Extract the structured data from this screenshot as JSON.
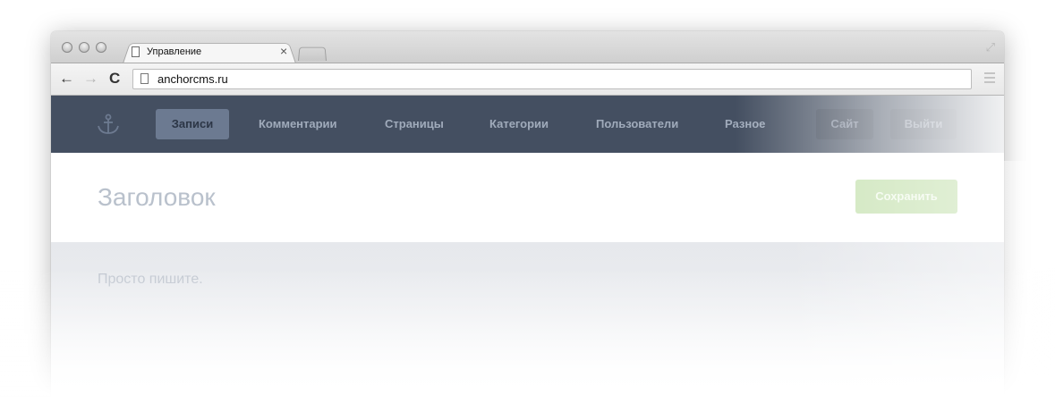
{
  "browser": {
    "tab_title": "Управление",
    "tab_close": "×",
    "url": "anchorcms.ru",
    "icons": {
      "back": "back-arrow-icon",
      "forward": "forward-arrow-icon",
      "reload": "reload-icon",
      "page": "document-icon",
      "menu": "menu-icon",
      "fullscreen": "fullscreen-icon"
    },
    "glyphs": {
      "back": "←",
      "forward": "→",
      "reload": "C",
      "fullscreen": "⤢"
    }
  },
  "nav": {
    "logo_icon": "anchor-icon",
    "items": [
      {
        "label": "Записи",
        "active": true
      },
      {
        "label": "Комментарии",
        "active": false
      },
      {
        "label": "Страницы",
        "active": false
      },
      {
        "label": "Категории",
        "active": false
      },
      {
        "label": "Пользователи",
        "active": false
      },
      {
        "label": "Разное",
        "active": false
      }
    ],
    "site_button": "Сайт",
    "logout_button": "Выйти"
  },
  "editor": {
    "title_placeholder": "Заголовок",
    "save_label": "Сохранить",
    "body_placeholder": "Просто пишите."
  },
  "colors": {
    "nav_bg": "#444f61",
    "nav_active": "#6c7a91",
    "save_button": "#cfe6bd"
  }
}
